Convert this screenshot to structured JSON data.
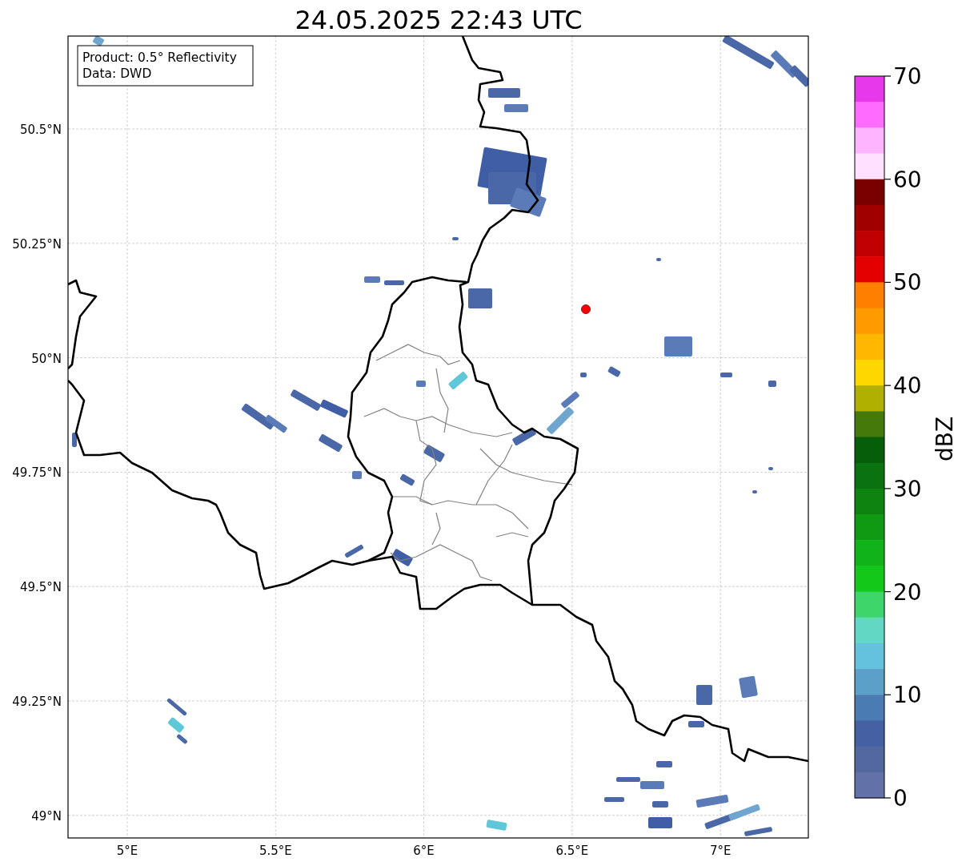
{
  "title": "24.05.2025 22:43 UTC",
  "legend": [
    "Product: 0.5° Reflectivity",
    "Data: DWD"
  ],
  "map": {
    "lat_ticks": [
      "50.5°N",
      "50.25°N",
      "50°N",
      "49.75°N",
      "49.5°N",
      "49.25°N",
      "49°N"
    ],
    "lon_ticks": [
      "5°E",
      "5.5°E",
      "6°E",
      "6.5°E",
      "7°E"
    ]
  },
  "colorbar": {
    "label": "dBZ",
    "ticks": [
      "70",
      "60",
      "50",
      "40",
      "30",
      "20",
      "10",
      "0"
    ],
    "bands": [
      {
        "color": "#e838ec"
      },
      {
        "color": "#ff6bff"
      },
      {
        "color": "#ffb4ff"
      },
      {
        "color": "#ffe0ff"
      },
      {
        "color": "#7a0000"
      },
      {
        "color": "#a00000"
      },
      {
        "color": "#c00000"
      },
      {
        "color": "#e40000"
      },
      {
        "color": "#ff7f00"
      },
      {
        "color": "#ff9a00"
      },
      {
        "color": "#ffb700"
      },
      {
        "color": "#ffd700"
      },
      {
        "color": "#b0b000"
      },
      {
        "color": "#457a0a"
      },
      {
        "color": "#075e0a"
      },
      {
        "color": "#0a720f"
      },
      {
        "color": "#0c840f"
      },
      {
        "color": "#0e9a12"
      },
      {
        "color": "#10b418"
      },
      {
        "color": "#12c91a"
      },
      {
        "color": "#3ed66a"
      },
      {
        "color": "#62d8c4"
      },
      {
        "color": "#65c2de"
      },
      {
        "color": "#5aa0c8"
      },
      {
        "color": "#4a7bb2"
      },
      {
        "color": "#4561a3"
      },
      {
        "color": "#52689f"
      },
      {
        "color": "#6272a8"
      }
    ]
  }
}
